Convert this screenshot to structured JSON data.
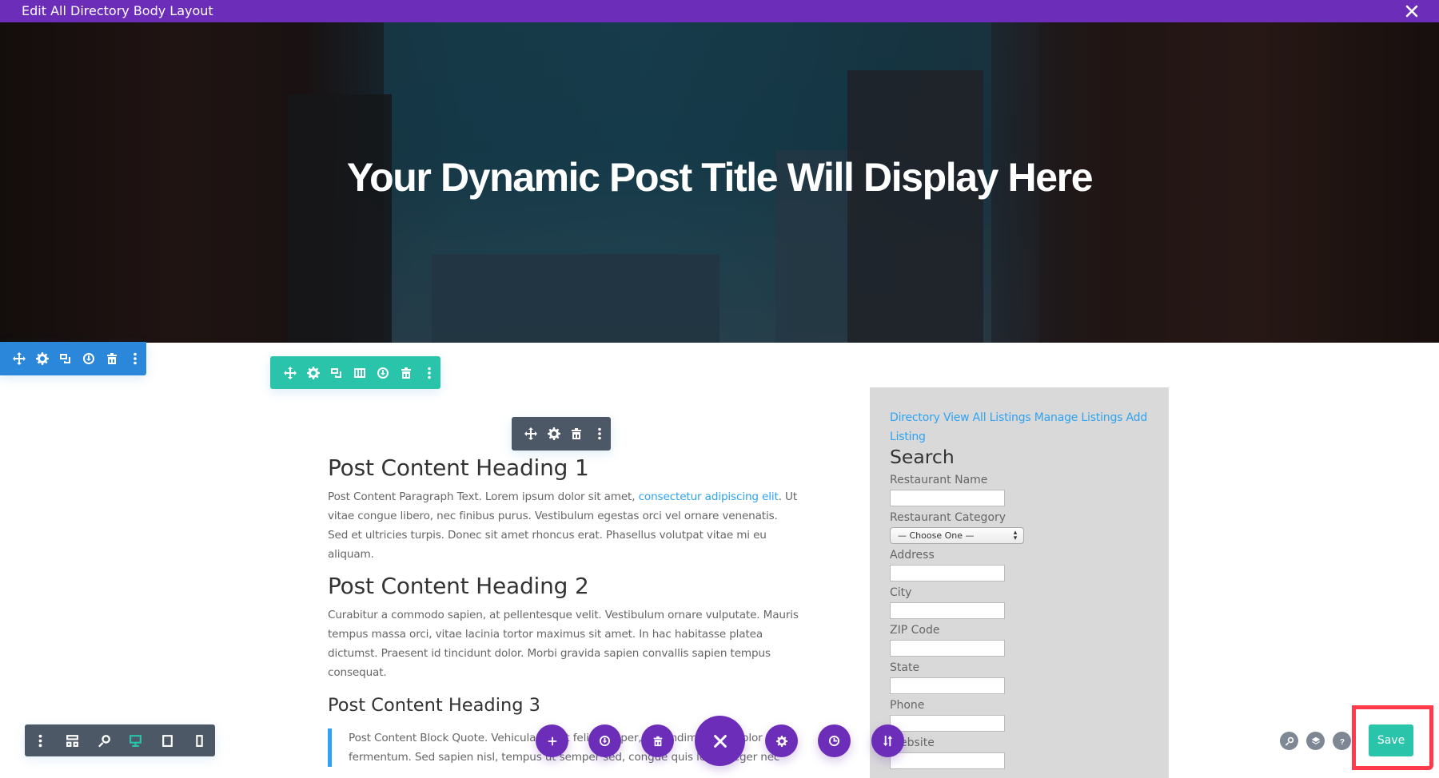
{
  "window": {
    "title": "Edit All Directory Body Layout",
    "close_icon": "close-icon"
  },
  "hero": {
    "title": "Your Dynamic Post Title Will Display Here"
  },
  "toolbars": {
    "section": [
      "move-icon",
      "gear-icon",
      "duplicate-icon",
      "save-to-library-icon",
      "trash-icon",
      "more-icon"
    ],
    "row": [
      "move-icon",
      "gear-icon",
      "duplicate-icon",
      "columns-icon",
      "save-to-library-icon",
      "trash-icon",
      "more-icon"
    ],
    "module": [
      "move-icon",
      "gear-icon",
      "trash-icon",
      "more-icon"
    ]
  },
  "content": {
    "heading1": "Post Content Heading 1",
    "paragraph1_before_link": "Post Content Paragraph Text. Lorem ipsum dolor sit amet, ",
    "paragraph1_link": "consectetur adipiscing elit",
    "paragraph1_after_link": ". Ut vitae congue libero, nec finibus purus. Vestibulum egestas orci vel ornare venenatis. Sed et ultricies turpis. Donec sit amet rhoncus erat. Phasellus volutpat vitae mi eu aliquam.",
    "heading2": "Post Content Heading 2",
    "paragraph2": "Curabitur a commodo sapien, at pellentesque velit. Vestibulum ornare vulputate. Mauris tempus massa orci, vitae lacinia tortor maximus sit amet. In hac habitasse platea dictumst. Praesent id tincidunt dolor. Morbi gravida sapien convallis sapien tempus consequat.",
    "heading3": "Post Content Heading 3",
    "blockquote": "Post Content Block Quote. Vehicula est ut felis semper, in condimentum dolor fermentum. Sed sapien nisl, tempus ut semper sed, congue quis leo. Integer nec"
  },
  "sidebar": {
    "links": [
      "Directory",
      "View All Listings",
      "Manage Listings",
      "Add Listing"
    ],
    "search_title": "Search",
    "fields": {
      "restaurant_name": {
        "label": "Restaurant Name",
        "value": ""
      },
      "restaurant_category": {
        "label": "Restaurant Category",
        "selected": "— Choose One —"
      },
      "address": {
        "label": "Address",
        "value": ""
      },
      "city": {
        "label": "City",
        "value": ""
      },
      "zip": {
        "label": "ZIP Code",
        "value": ""
      },
      "state": {
        "label": "State",
        "value": ""
      },
      "phone": {
        "label": "Phone",
        "value": ""
      },
      "website": {
        "label": "Website",
        "value": ""
      }
    }
  },
  "view_bar": {
    "items": [
      "more-icon",
      "wireframe-icon",
      "zoom-icon",
      "desktop-icon",
      "tablet-icon",
      "phone-icon"
    ],
    "active": "desktop-icon"
  },
  "fab_bar": {
    "items": [
      "add-icon",
      "save-to-library-icon",
      "trash-icon",
      "close-icon",
      "gear-icon",
      "history-icon",
      "portability-icon"
    ]
  },
  "bottom_right": {
    "items": [
      "search-icon",
      "layers-icon",
      "help-icon"
    ],
    "save_label": "Save"
  },
  "colors": {
    "purple": "#6c2eb9",
    "section_blue": "#2b87da",
    "row_green": "#29c4a9",
    "module_dark": "#4c5866",
    "link_blue": "#2ea3f2",
    "highlight_red": "#ff3a4a"
  }
}
